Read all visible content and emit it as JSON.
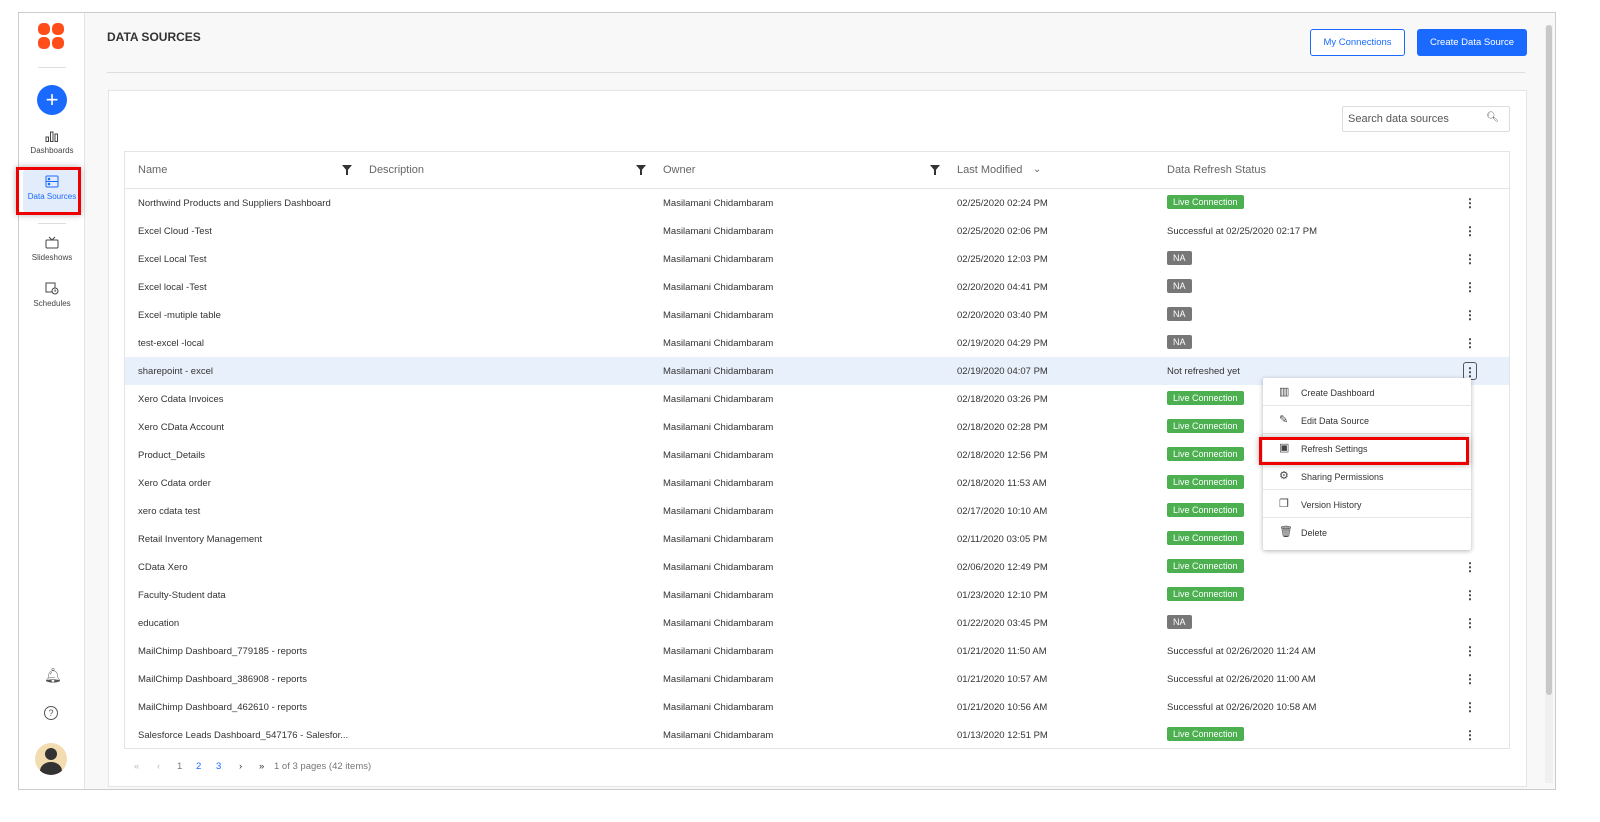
{
  "sidebar": {
    "items": [
      {
        "label": "Dashboards"
      },
      {
        "label": "Data Sources"
      },
      {
        "label": "Slideshows"
      },
      {
        "label": "Schedules"
      }
    ]
  },
  "header": {
    "title": "DATA SOURCES",
    "my_connections": "My Connections",
    "create": "Create Data Source"
  },
  "search": {
    "placeholder": "Search data sources"
  },
  "columns": [
    "Name",
    "Description",
    "Owner",
    "Last Modified",
    "Data Refresh Status"
  ],
  "rows": [
    {
      "name": "Northwind Products and Suppliers Dashboard",
      "owner": "Masilamani Chidambaram",
      "modified": "02/25/2020 02:24 PM",
      "status": "Live Connection",
      "kind": "live"
    },
    {
      "name": "Excel Cloud -Test",
      "owner": "Masilamani Chidambaram",
      "modified": "02/25/2020 02:06 PM",
      "status": "Successful at 02/25/2020 02:17 PM",
      "kind": "text"
    },
    {
      "name": "Excel Local Test",
      "owner": "Masilamani Chidambaram",
      "modified": "02/25/2020 12:03 PM",
      "status": "NA",
      "kind": "na"
    },
    {
      "name": "Excel local -Test",
      "owner": "Masilamani Chidambaram",
      "modified": "02/20/2020 04:41 PM",
      "status": "NA",
      "kind": "na"
    },
    {
      "name": "Excel -mutiple table",
      "owner": "Masilamani Chidambaram",
      "modified": "02/20/2020 03:40 PM",
      "status": "NA",
      "kind": "na"
    },
    {
      "name": "test-excel -local",
      "owner": "Masilamani Chidambaram",
      "modified": "02/19/2020 04:29 PM",
      "status": "NA",
      "kind": "na"
    },
    {
      "name": "sharepoint - excel",
      "owner": "Masilamani Chidambaram",
      "modified": "02/19/2020 04:07 PM",
      "status": "Not refreshed yet",
      "kind": "text"
    },
    {
      "name": "Xero Cdata Invoices",
      "owner": "Masilamani Chidambaram",
      "modified": "02/18/2020 03:26 PM",
      "status": "Live Connection",
      "kind": "live"
    },
    {
      "name": "Xero CData Account",
      "owner": "Masilamani Chidambaram",
      "modified": "02/18/2020 02:28 PM",
      "status": "Live Connection",
      "kind": "live"
    },
    {
      "name": "Product_Details",
      "owner": "Masilamani Chidambaram",
      "modified": "02/18/2020 12:56 PM",
      "status": "Live Connection",
      "kind": "live"
    },
    {
      "name": "Xero Cdata order",
      "owner": "Masilamani Chidambaram",
      "modified": "02/18/2020 11:53 AM",
      "status": "Live Connection",
      "kind": "live"
    },
    {
      "name": "xero cdata test",
      "owner": "Masilamani Chidambaram",
      "modified": "02/17/2020 10:10 AM",
      "status": "Live Connection",
      "kind": "live"
    },
    {
      "name": "Retail Inventory Management",
      "owner": "Masilamani Chidambaram",
      "modified": "02/11/2020 03:05 PM",
      "status": "Live Connection",
      "kind": "live"
    },
    {
      "name": "CData Xero",
      "owner": "Masilamani Chidambaram",
      "modified": "02/06/2020 12:49 PM",
      "status": "Live Connection",
      "kind": "live"
    },
    {
      "name": "Faculty-Student data",
      "owner": "Masilamani Chidambaram",
      "modified": "01/23/2020 12:10 PM",
      "status": "Live Connection",
      "kind": "live"
    },
    {
      "name": "education",
      "owner": "Masilamani Chidambaram",
      "modified": "01/22/2020 03:45 PM",
      "status": "NA",
      "kind": "na"
    },
    {
      "name": "MailChimp Dashboard_779185 - reports",
      "owner": "Masilamani Chidambaram",
      "modified": "01/21/2020 11:50 AM",
      "status": "Successful at 02/26/2020 11:24 AM",
      "kind": "text"
    },
    {
      "name": "MailChimp Dashboard_386908 - reports",
      "owner": "Masilamani Chidambaram",
      "modified": "01/21/2020 10:57 AM",
      "status": "Successful at 02/26/2020 11:00 AM",
      "kind": "text"
    },
    {
      "name": "MailChimp Dashboard_462610 - reports",
      "owner": "Masilamani Chidambaram",
      "modified": "01/21/2020 10:56 AM",
      "status": "Successful at 02/26/2020 10:58 AM",
      "kind": "text"
    },
    {
      "name": "Salesforce Leads Dashboard_547176 - Salesfor...",
      "owner": "Masilamani Chidambaram",
      "modified": "01/13/2020 12:51 PM",
      "status": "Live Connection",
      "kind": "live"
    }
  ],
  "menu": [
    {
      "label": "Create Dashboard",
      "icon": "bar-chart-icon"
    },
    {
      "label": "Edit Data Source",
      "icon": "pencil-icon"
    },
    {
      "label": "Refresh Settings",
      "icon": "calendar-clock-icon"
    },
    {
      "label": "Sharing Permissions",
      "icon": "user-gear-icon"
    },
    {
      "label": "Version History",
      "icon": "versions-icon"
    },
    {
      "label": "Delete",
      "icon": "trash-icon"
    }
  ],
  "pager": {
    "pages": [
      "1",
      "2",
      "3"
    ],
    "summary": "1 of 3 pages (42 items)"
  },
  "colors": {
    "accent": "#1a6aff",
    "live": "#4caf50",
    "logo": "#ff4d1a"
  }
}
